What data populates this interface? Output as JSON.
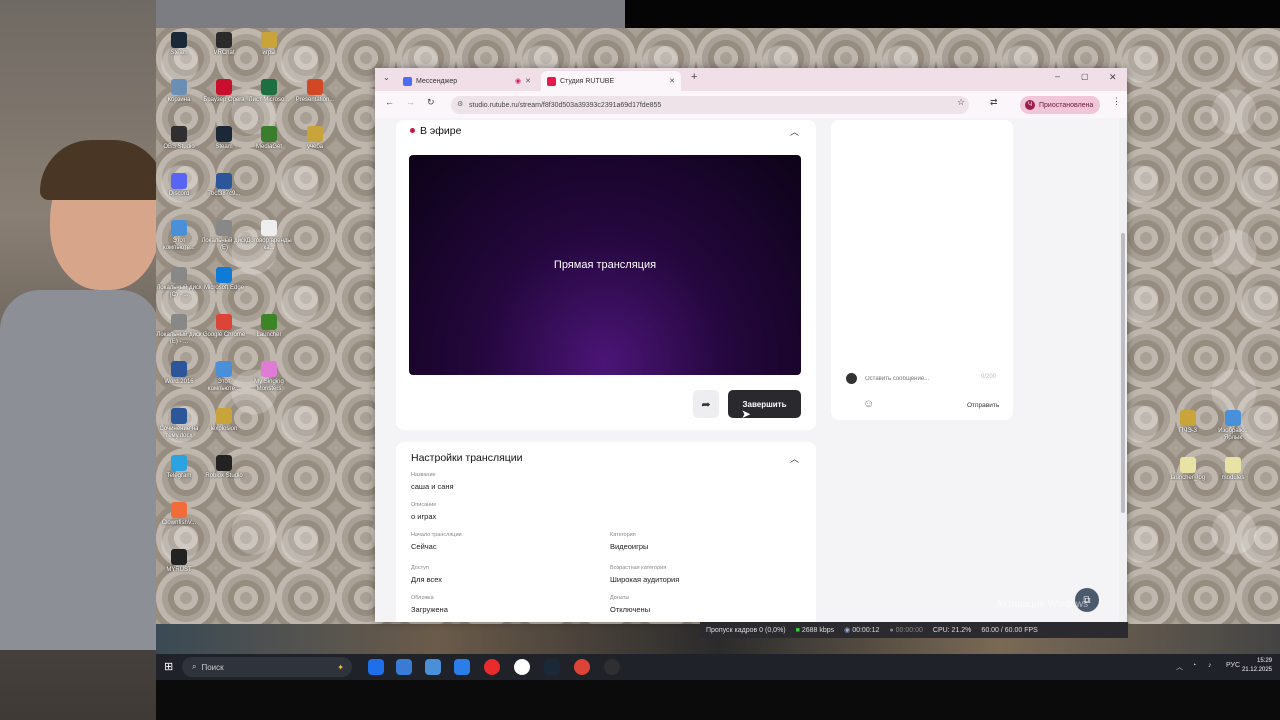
{
  "desktop": {
    "icons": [
      {
        "label": "Steam",
        "color": "#1b2838"
      },
      {
        "label": "VRChat",
        "color": "#2b2b2b"
      },
      {
        "label": "игры",
        "color": "#c9a43a"
      },
      {
        "label": "Корзина",
        "color": "#6a8fb5"
      },
      {
        "label": "Браузер Opera",
        "color": "#c8102e"
      },
      {
        "label": "Лист Microsо...",
        "color": "#1d6f42"
      },
      {
        "label": "Presentation...",
        "color": "#d24726"
      },
      {
        "label": "OBS Studio",
        "color": "#302e31"
      },
      {
        "label": "Steam",
        "color": "#1b2838"
      },
      {
        "label": "MediaGet",
        "color": "#3a7d2c"
      },
      {
        "label": "учеба",
        "color": "#c9a43a"
      },
      {
        "label": "Discord",
        "color": "#5865f2"
      },
      {
        "label": "7bcf387c9...",
        "color": "#2b579a"
      },
      {
        "label": "Этот компьюте...",
        "color": "#4a90d9"
      },
      {
        "label": "Локальный диск (E)",
        "color": "#888"
      },
      {
        "label": "Договор аренды ка...",
        "color": "#eee"
      },
      {
        "label": "Локальный диск (C) - ...",
        "color": "#888"
      },
      {
        "label": "Microsoft Edge",
        "color": "#0f7bd9"
      },
      {
        "label": "Локальный диск (E) - ...",
        "color": "#888"
      },
      {
        "label": "Google Chrome",
        "color": "#db4437"
      },
      {
        "label": "Launcher",
        "color": "#3c8527"
      },
      {
        "label": "Word 2016",
        "color": "#2b579a"
      },
      {
        "label": "Этот компьюте...",
        "color": "#4a90d9"
      },
      {
        "label": "My Singing Monsters",
        "color": "#e07bd6"
      },
      {
        "label": "Сочинение на тему.docx",
        "color": "#2b579a"
      },
      {
        "label": "lexplosion",
        "color": "#c9a43a"
      },
      {
        "label": "Telegram",
        "color": "#2aa3e0"
      },
      {
        "label": "Roblox Studio",
        "color": "#222"
      },
      {
        "label": "ClownfishV...",
        "color": "#f26b3a"
      },
      {
        "label": "MYRUST",
        "color": "#222"
      }
    ],
    "right_icons": [
      {
        "label": "ПЧЭ-3",
        "color": "#c9a43a"
      },
      {
        "label": "Изображ... Ярлык",
        "color": "#4a90d9"
      },
      {
        "label": "launcher_log",
        "color": "#e9e2a5"
      },
      {
        "label": "modules",
        "color": "#e9e2a5"
      }
    ]
  },
  "browser": {
    "tabs": [
      {
        "label": "Мессенджер"
      },
      {
        "label": "Студия RUTUBE"
      }
    ],
    "url": "studio.rutube.ru/stream/f8f30d503a39393c2391a69d17fde855",
    "profile_label": "Приостановлена"
  },
  "live": {
    "title": "В эфире",
    "preview_text": "Прямая трансляция",
    "end_label": "Завершить"
  },
  "chat": {
    "placeholder": "Оставить сообщение...",
    "counter": "0/200",
    "send_label": "Отправить"
  },
  "settings": {
    "title": "Настройки трансляции",
    "fields": {
      "name_label": "Название",
      "name_value": "саша и саня",
      "desc_label": "Описание",
      "desc_value": "о играх",
      "start_label": "Начало трансляции",
      "start_value": "Сейчас",
      "category_label": "Категория",
      "category_value": "Видеоигры",
      "access_label": "Доступ",
      "access_value": "Для всех",
      "age_label": "Возрастная категория",
      "age_value": "Широкая аудитория",
      "cover_label": "Обложка",
      "cover_value": "Загружена",
      "donate_label": "Донаты",
      "donate_value": "Отключены"
    }
  },
  "obs": {
    "dropped": "Пропуск кадров 0 (0,0%)",
    "bitrate": "2688 kbps",
    "live_time": "00:00:12",
    "rec_time": "00:00:00",
    "cpu": "CPU: 21.2%",
    "fps": "60.00 / 60.00 FPS"
  },
  "taskbar": {
    "search_placeholder": "Поиск",
    "lang": "РУС",
    "time": "15:29",
    "date": "21.12.2025"
  },
  "watermark": "Активация Windows"
}
